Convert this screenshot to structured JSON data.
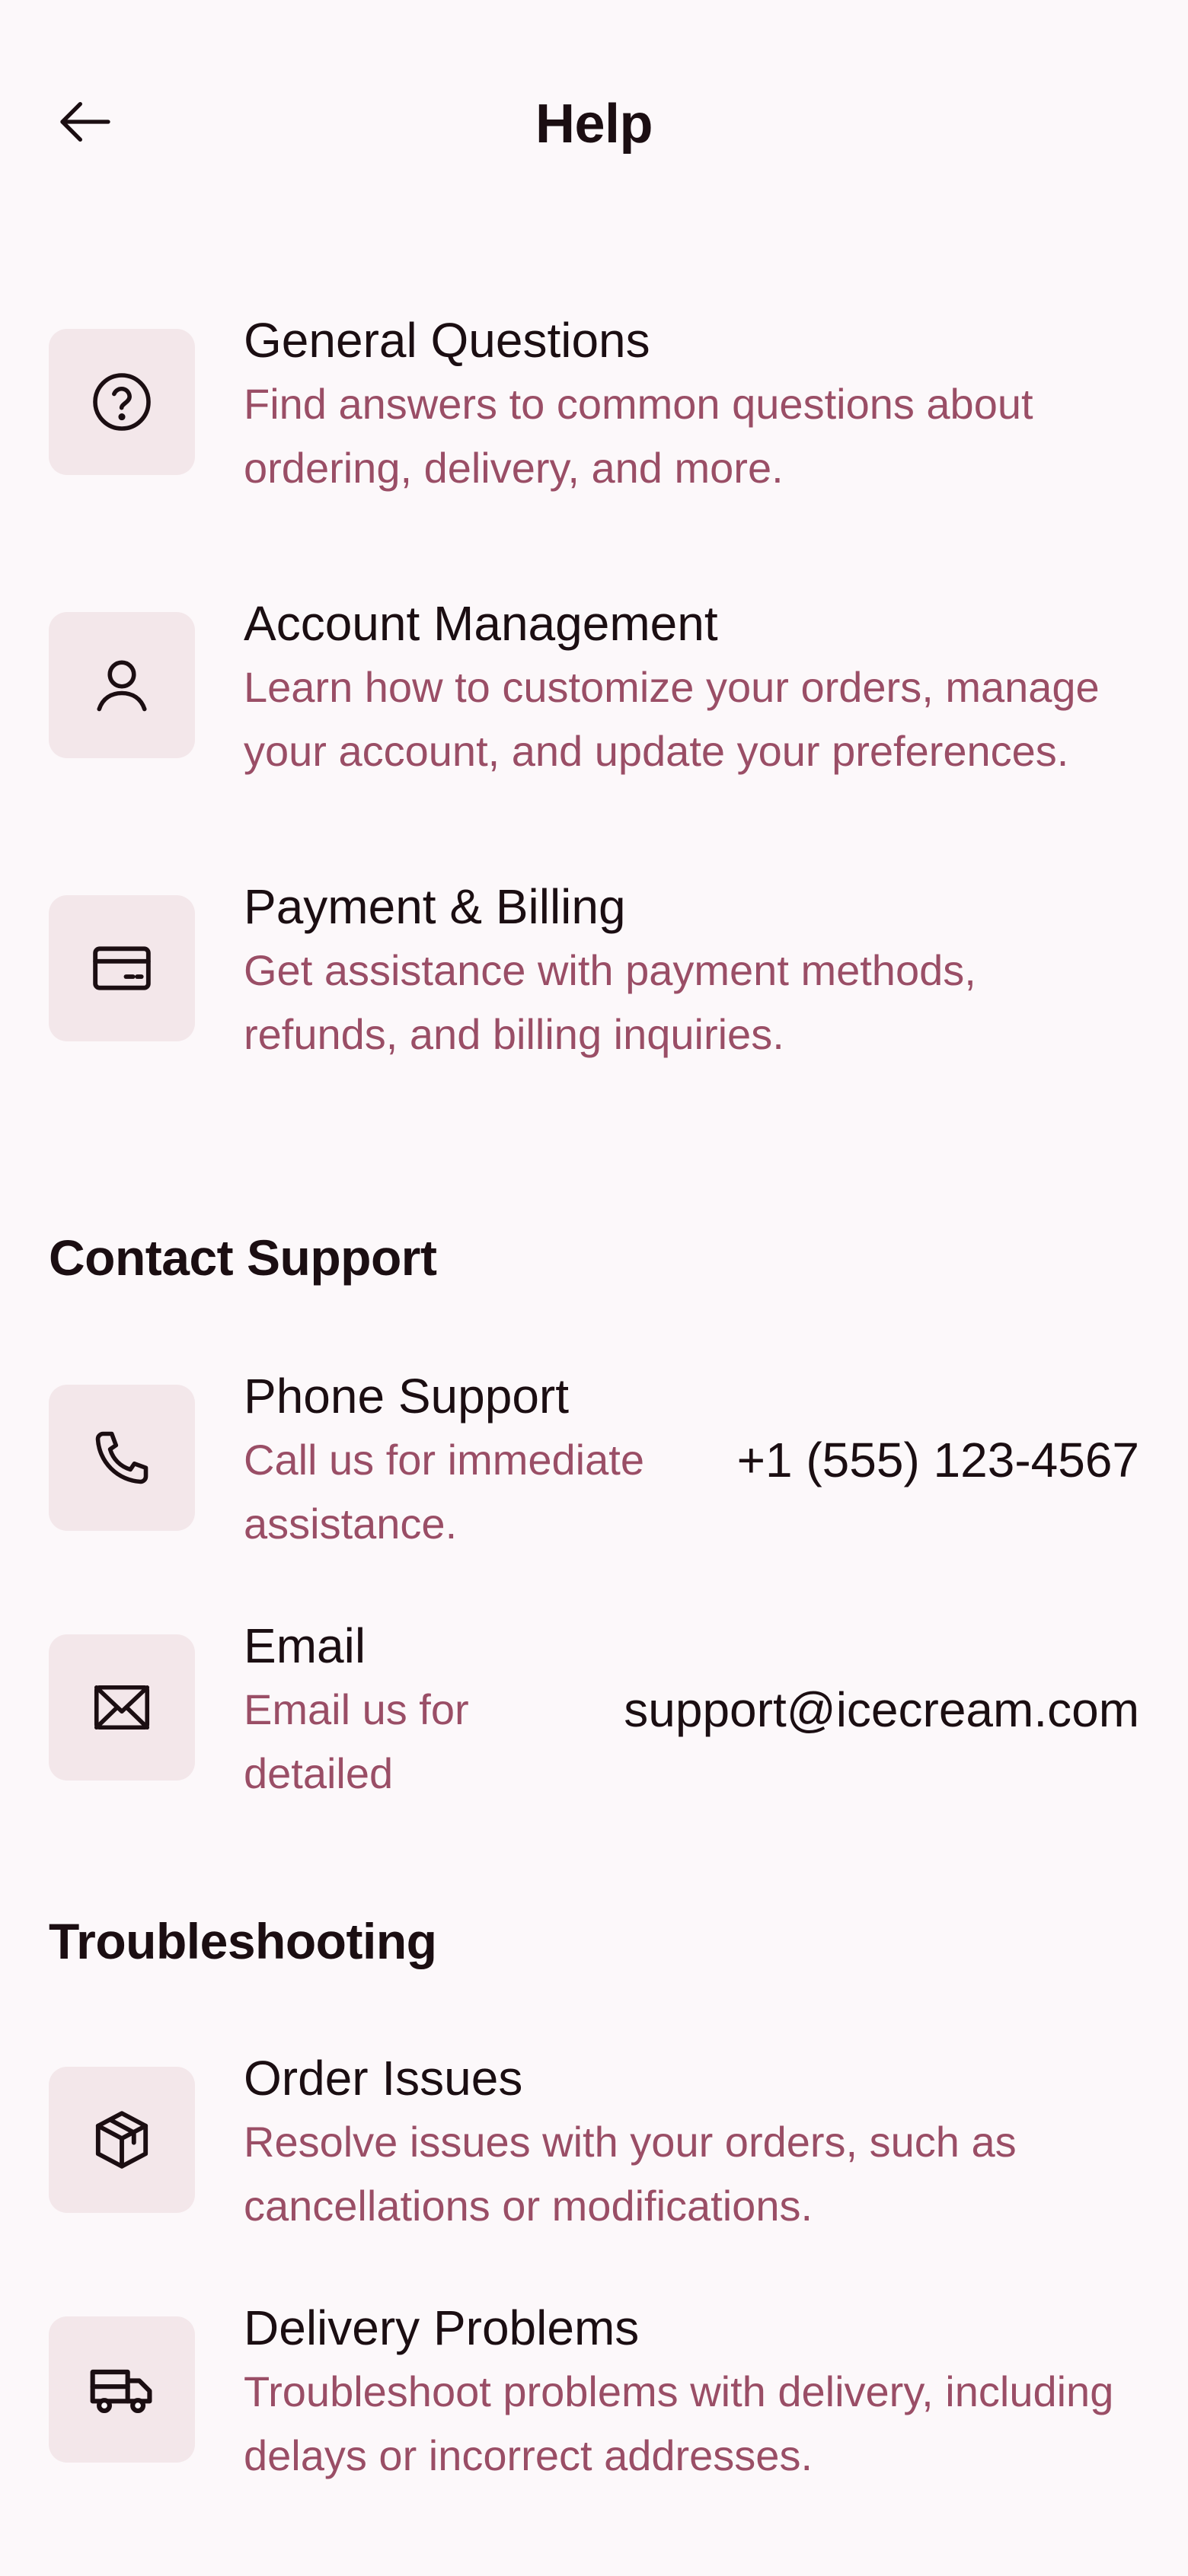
{
  "header": {
    "title": "Help"
  },
  "topics": [
    {
      "title": "General Questions",
      "description": "Find answers to common questions about ordering, delivery, and more.",
      "icon": "question-circle-icon"
    },
    {
      "title": "Account Management",
      "description": "Learn how to customize your orders, manage your account, and update your preferences.",
      "icon": "user-icon"
    },
    {
      "title": "Payment & Billing",
      "description": "Get assistance with payment methods, refunds, and billing inquiries.",
      "icon": "credit-card-icon"
    }
  ],
  "contact": {
    "heading": "Contact Support",
    "phone": {
      "title": "Phone Support",
      "description": "Call us for immediate assistance.",
      "value": "+1 (555) 123-4567",
      "icon": "phone-icon"
    },
    "email": {
      "title": "Email",
      "description": "Email us for detailed",
      "value": "support@icecream.com",
      "icon": "mail-icon"
    }
  },
  "troubleshooting": {
    "heading": "Troubleshooting",
    "items": [
      {
        "title": "Order Issues",
        "description": "Resolve issues with your orders, such as cancellations or modifications.",
        "icon": "package-icon"
      },
      {
        "title": "Delivery Problems",
        "description": "Troubleshoot problems with delivery, including delays or incorrect addresses.",
        "icon": "truck-icon"
      }
    ]
  },
  "colors": {
    "background": "#fcf8fa",
    "icon_tile": "#f3e7ea",
    "primary_text": "#1b0e12",
    "secondary_text": "#9a4e66"
  }
}
